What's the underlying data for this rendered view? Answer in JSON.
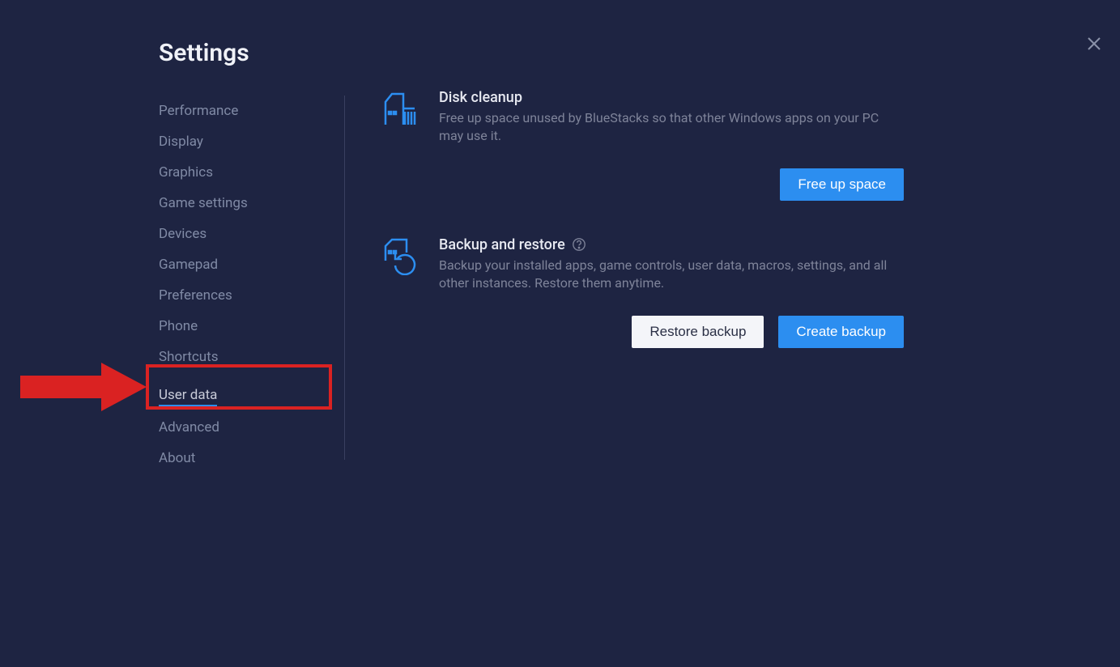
{
  "title": "Settings",
  "sidebar": {
    "items": [
      {
        "label": "Performance",
        "active": false
      },
      {
        "label": "Display",
        "active": false
      },
      {
        "label": "Graphics",
        "active": false
      },
      {
        "label": "Game settings",
        "active": false
      },
      {
        "label": "Devices",
        "active": false
      },
      {
        "label": "Gamepad",
        "active": false
      },
      {
        "label": "Preferences",
        "active": false
      },
      {
        "label": "Phone",
        "active": false
      },
      {
        "label": "Shortcuts",
        "active": false
      },
      {
        "label": "User data",
        "active": true
      },
      {
        "label": "Advanced",
        "active": false
      },
      {
        "label": "About",
        "active": false
      }
    ]
  },
  "sections": {
    "disk_cleanup": {
      "title": "Disk cleanup",
      "desc": "Free up space unused by BlueStacks so that other Windows apps on your PC may use it.",
      "button": "Free up space"
    },
    "backup_restore": {
      "title": "Backup and restore",
      "desc": "Backup your installed apps, game controls, user data, macros, settings, and all other instances. Restore them anytime.",
      "restore_button": "Restore backup",
      "create_button": "Create backup"
    }
  }
}
